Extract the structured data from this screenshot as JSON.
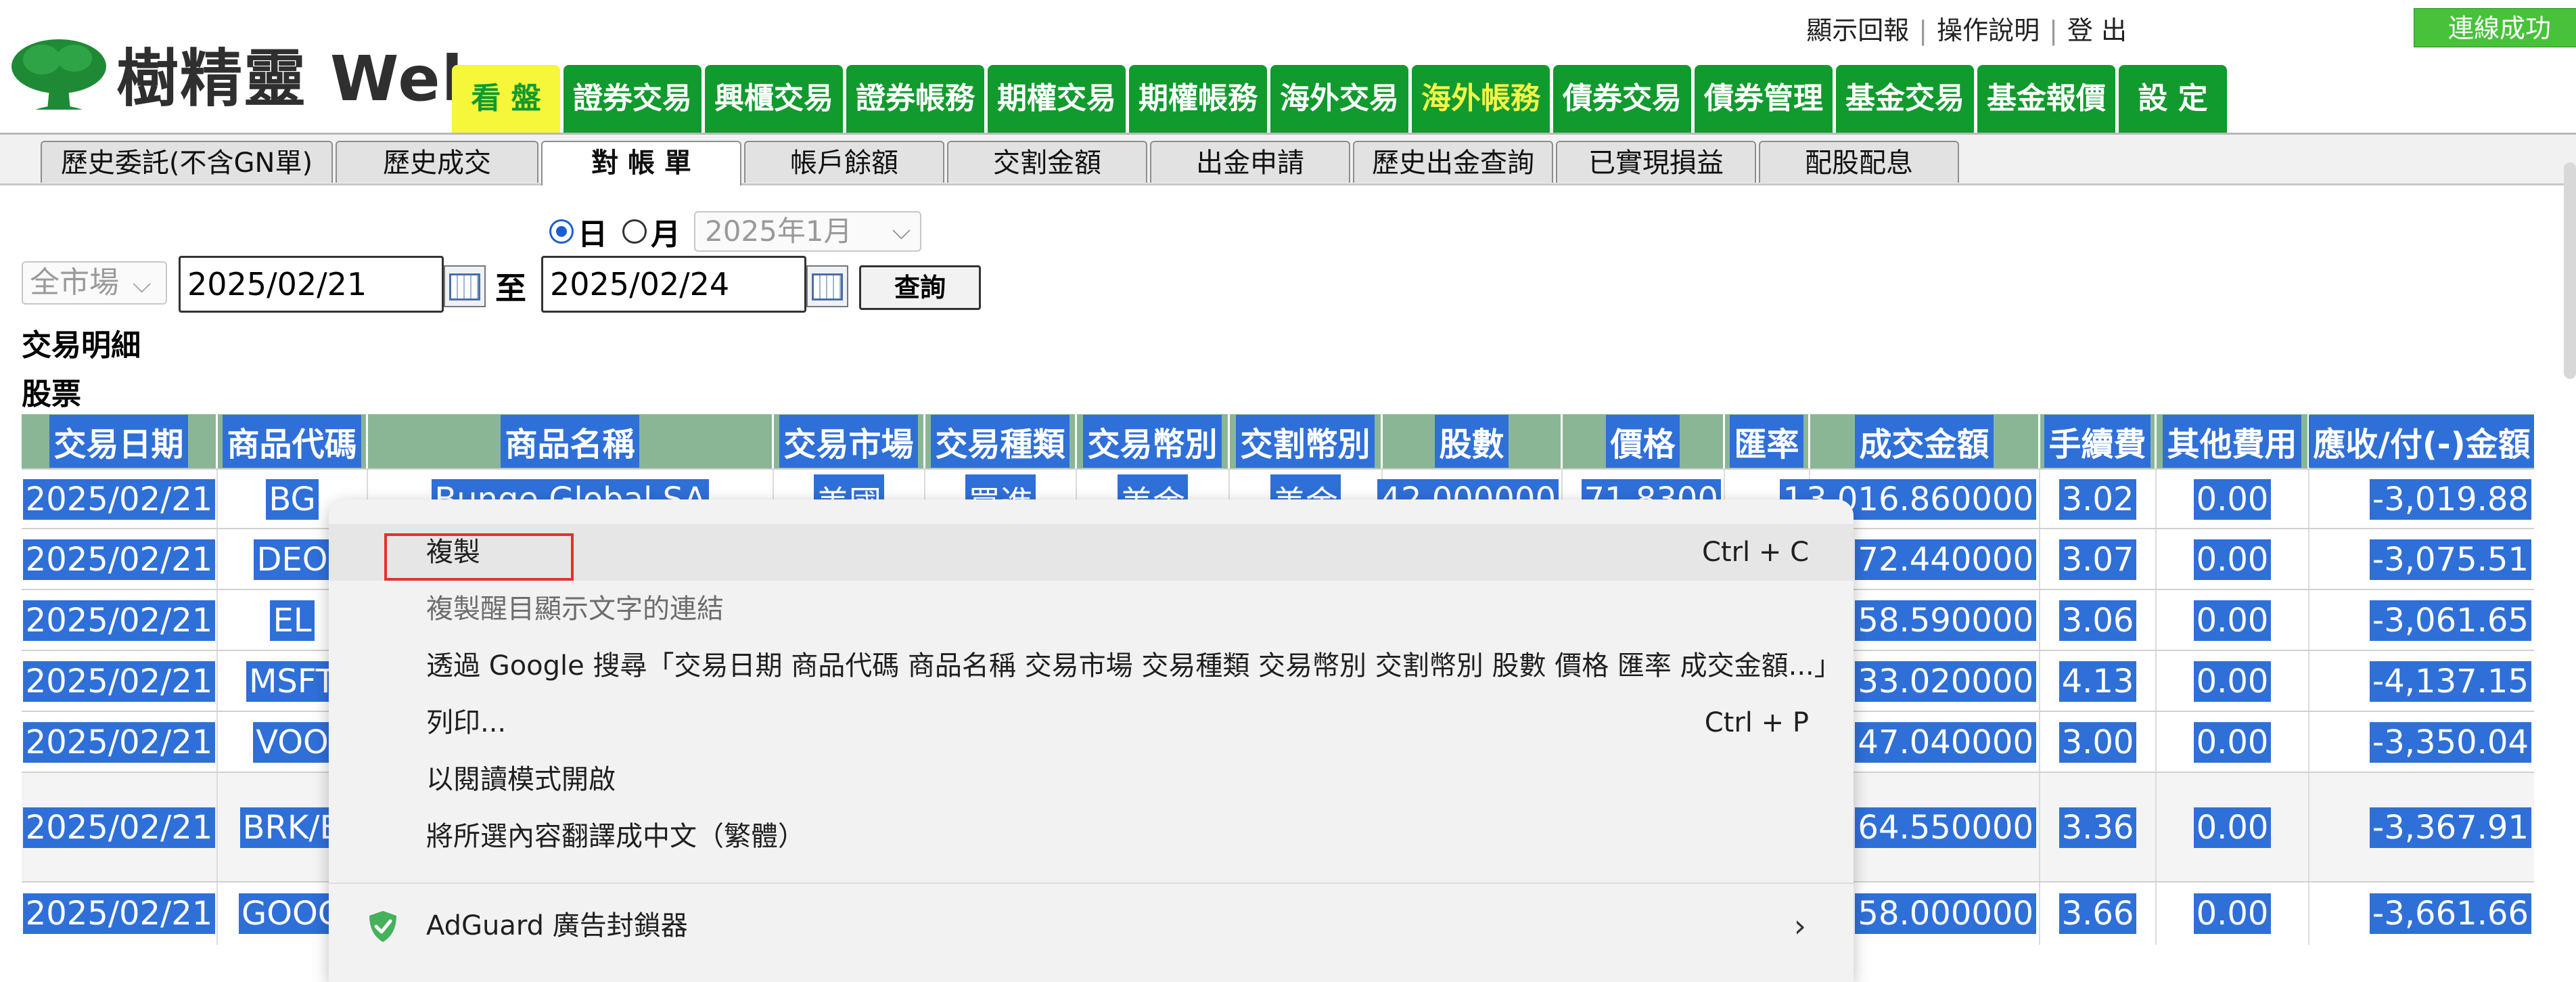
{
  "header": {
    "logo_text": "樹精靈 Web",
    "links": [
      "顯示回報",
      "操作說明",
      "登 出"
    ],
    "connection_status": "連線成功"
  },
  "nav_tabs": [
    {
      "label": "看 盤",
      "style": "yellow-bg"
    },
    {
      "label": "證券交易",
      "style": ""
    },
    {
      "label": "興櫃交易",
      "style": ""
    },
    {
      "label": "證券帳務",
      "style": ""
    },
    {
      "label": "期權交易",
      "style": ""
    },
    {
      "label": "期權帳務",
      "style": ""
    },
    {
      "label": "海外交易",
      "style": ""
    },
    {
      "label": "海外帳務",
      "style": "yellow-text"
    },
    {
      "label": "債券交易",
      "style": ""
    },
    {
      "label": "債券管理",
      "style": ""
    },
    {
      "label": "基金交易",
      "style": ""
    },
    {
      "label": "基金報價",
      "style": ""
    },
    {
      "label": "設 定",
      "style": ""
    }
  ],
  "sub_tabs": [
    {
      "label": "歷史委託(不含GN單)",
      "active": false
    },
    {
      "label": "歷史成交",
      "active": false
    },
    {
      "label": "對 帳 單",
      "active": true
    },
    {
      "label": "帳戶餘額",
      "active": false
    },
    {
      "label": "交割金額",
      "active": false
    },
    {
      "label": "出金申請",
      "active": false
    },
    {
      "label": "歷史出金查詢",
      "active": false
    },
    {
      "label": "已實現損益",
      "active": false
    },
    {
      "label": "配股配息",
      "active": false
    }
  ],
  "filters": {
    "radio_day": "日",
    "radio_month": "月",
    "selected_period": "日",
    "month_select": "2025年1月",
    "market_select": "全市場",
    "date_from": "2025/02/21",
    "to_label": "至",
    "date_to": "2025/02/24",
    "query_button": "查詢"
  },
  "section": {
    "title": "交易明細",
    "subtitle": "股票"
  },
  "table": {
    "headers": [
      "交易日期",
      "商品代碼",
      "商品名稱",
      "交易市場",
      "交易種類",
      "交易幣別",
      "交割幣別",
      "股數",
      "價格",
      "匯率",
      "成交金額",
      "手續費",
      "其他費用",
      "應收/付(-)金額"
    ],
    "rows": [
      {
        "date": "2025/02/21",
        "code": "BG",
        "name": "Bunge Global SA",
        "market": "美國",
        "type": "買進",
        "trade_ccy": "美金",
        "settle_ccy": "美金",
        "shares": "42.000000",
        "price": "71.8300",
        "rate": "1",
        "amount": "3,016.860000",
        "fee": "3.02",
        "other": "0.00",
        "net": "-3,019.88"
      },
      {
        "date": "2025/02/21",
        "code": "DEO",
        "amount_tail": "72.440000",
        "fee": "3.07",
        "other": "0.00",
        "net": "-3,075.51"
      },
      {
        "date": "2025/02/21",
        "code": "EL",
        "amount_tail": "58.590000",
        "fee": "3.06",
        "other": "0.00",
        "net": "-3,061.65"
      },
      {
        "date": "2025/02/21",
        "code": "MSFT",
        "amount_tail": "33.020000",
        "fee": "4.13",
        "other": "0.00",
        "net": "-4,137.15"
      },
      {
        "date": "2025/02/21",
        "code": "VOO",
        "amount_tail": "47.040000",
        "fee": "3.00",
        "other": "0.00",
        "net": "-3,350.04"
      },
      {
        "date": "2025/02/21",
        "code": "BRK/B",
        "amount_tail": "64.550000",
        "fee": "3.36",
        "other": "0.00",
        "net": "-3,367.91"
      },
      {
        "date": "2025/02/21",
        "code": "GOOG",
        "amount_tail": "58.000000",
        "fee": "3.66",
        "other": "0.00",
        "net": "-3,661.66"
      }
    ]
  },
  "context_menu": {
    "items": [
      {
        "label": "複製",
        "shortcut": "Ctrl + C"
      },
      {
        "label": "複製醒目顯示文字的連結",
        "shortcut": ""
      },
      {
        "label": "透過 Google 搜尋「交易日期 商品代碼 商品名稱 交易市場 交易種類 交易幣別 交割幣別 股數 價格 匯率 成交金額...」",
        "shortcut": ""
      },
      {
        "label": "列印...",
        "shortcut": "Ctrl + P"
      },
      {
        "label": "以閱讀模式開啟",
        "shortcut": ""
      },
      {
        "label": "將所選內容翻譯成中文（繁體）",
        "shortcut": ""
      },
      {
        "label": "AdGuard 廣告封鎖器",
        "shortcut": ""
      }
    ]
  },
  "colors": {
    "nav_green": "#119a2e",
    "selection_blue": "#2f6fd8",
    "header_row_green": "#8bb696",
    "highlight_box_red": "#e0332b",
    "connected_green": "#47c23a"
  }
}
